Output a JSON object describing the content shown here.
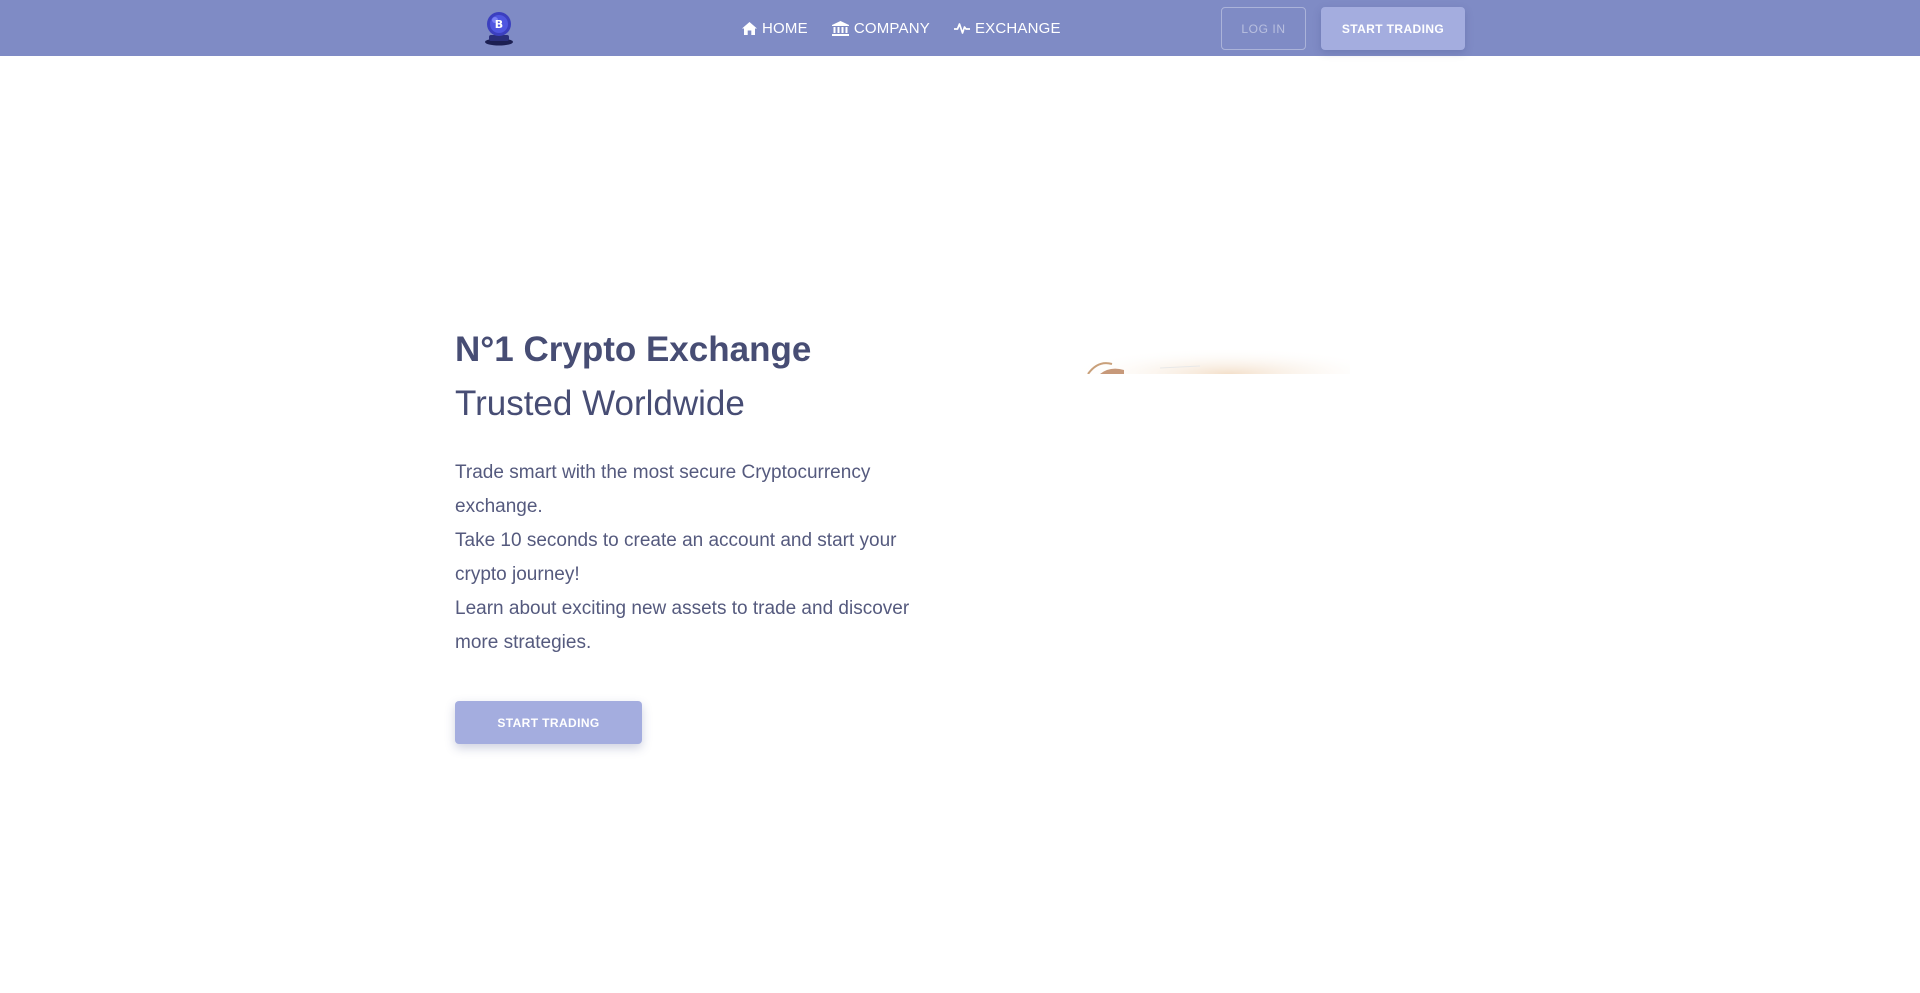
{
  "nav": {
    "logo_icon": "bitcoin-globe-logo",
    "links": [
      {
        "label": "HOME",
        "icon": "home-icon"
      },
      {
        "label": "COMPANY",
        "icon": "bank-icon"
      },
      {
        "label": "EXCHANGE",
        "icon": "pulse-icon"
      }
    ],
    "login_label": "LOG IN",
    "start_trading_label": "START TRADING"
  },
  "hero": {
    "title": "N°1 Crypto Exchange",
    "subtitle": "Trusted Worldwide",
    "paragraphs": [
      "Trade smart with the most secure Cryptocurrency exchange.",
      "Take 10 seconds to create an account and start your crypto journey!",
      "Learn about exciting new assets to trade and discover more strategies."
    ],
    "cta_label": "START TRADING",
    "image_icon": "hero-illustration"
  },
  "colors": {
    "navbar_bg": "#7f8bc5",
    "button_bg": "#a4addf",
    "heading_text": "#474d74",
    "body_text": "#555a7e",
    "page_bg": "#ffffff"
  }
}
